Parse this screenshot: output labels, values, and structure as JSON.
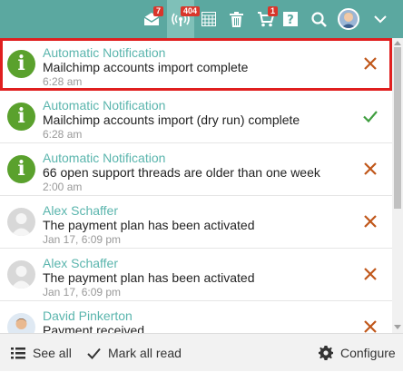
{
  "topbar": {
    "messages_badge": "7",
    "activity_badge": "404",
    "cart_badge": "1",
    "icons": [
      "envelope-icon",
      "activity-icon",
      "calendar-icon",
      "trash-icon",
      "cart-icon",
      "help-icon",
      "search-icon",
      "user-avatar",
      "chevron-down-icon"
    ]
  },
  "notifications": [
    {
      "title": "Automatic Notification",
      "message": "Mailchimp accounts import complete",
      "time": "6:28 am",
      "icon": "info-icon",
      "action": "dismiss-x",
      "highlighted": true
    },
    {
      "title": "Automatic Notification",
      "message": "Mailchimp accounts import (dry run) complete",
      "time": "6:28 am",
      "icon": "info-icon",
      "action": "mark-read-check"
    },
    {
      "title": "Automatic Notification",
      "message": "66 open support threads are older than one week",
      "time": "2:00 am",
      "icon": "info-icon",
      "action": "dismiss-x"
    },
    {
      "title": "Alex Schaffer",
      "message": "The payment plan has been activated",
      "time": "Jan 17, 6:09 pm",
      "icon": "default-avatar",
      "action": "dismiss-x"
    },
    {
      "title": "Alex Schaffer",
      "message": "The payment plan has been activated",
      "time": "Jan 17, 6:09 pm",
      "icon": "default-avatar",
      "action": "dismiss-x"
    },
    {
      "title": "David Pinkerton",
      "message": "Payment received",
      "time": "",
      "icon": "photo-avatar",
      "action": "dismiss-x"
    }
  ],
  "footer": {
    "see_all": "See all",
    "mark_all_read": "Mark all read",
    "configure": "Configure"
  },
  "colors": {
    "topbar": "#5ba8a0",
    "title": "#5ab5ad",
    "info_icon": "#5aa12d",
    "dismiss": "#c0571a",
    "check": "#3f9e3f",
    "highlight": "#e01f1f",
    "badge": "#d9362b"
  }
}
